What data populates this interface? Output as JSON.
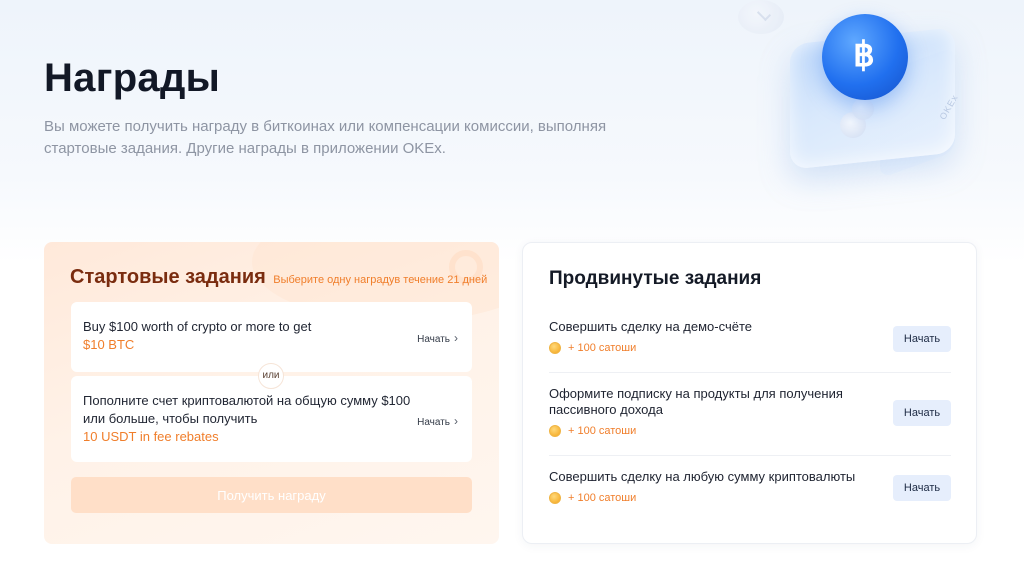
{
  "header": {
    "title": "Награды",
    "description": "Вы можете получить награду в биткоинах или компенсации комиссии, выполняя стартовые задания. Другие награды в приложении OKEx."
  },
  "hero": {
    "cube_label": "OKEx",
    "coin_symbol": "฿"
  },
  "starter": {
    "title": "Стартовые задания",
    "hint": "Выберите одну наградув течение 21 дней",
    "or_label": "или",
    "tasks": [
      {
        "text": "Buy $100 worth of crypto or more to get",
        "reward": "$10 BTC",
        "start_label": "Начать"
      },
      {
        "text": "Пополните счет криптовалютой на общую сумму $100 или больше, чтобы получить",
        "reward": "10 USDT in fee rebates",
        "start_label": "Начать"
      }
    ],
    "claim_label": "Получить награду"
  },
  "advanced": {
    "title": "Продвинутые задания",
    "tasks": [
      {
        "text": "Совершить сделку на демо-счёте",
        "reward": "+ 100 сатоши",
        "button": "Начать"
      },
      {
        "text": "Оформите подписку на продукты для получения пассивного дохода",
        "reward": "+ 100 сатоши",
        "button": "Начать"
      },
      {
        "text": "Совершить сделку на любую сумму криптовалюты",
        "reward": "+ 100 сатоши",
        "button": "Начать"
      }
    ]
  },
  "colors": {
    "accent_orange": "#f07e2b",
    "title_brown": "#7a2c0f",
    "button_blue_bg": "#e6eefc",
    "claim_disabled_bg": "#ffdfc8"
  },
  "icons": [
    "bitcoin-coin-icon",
    "chevron-right-icon",
    "satoshi-coin-icon"
  ]
}
